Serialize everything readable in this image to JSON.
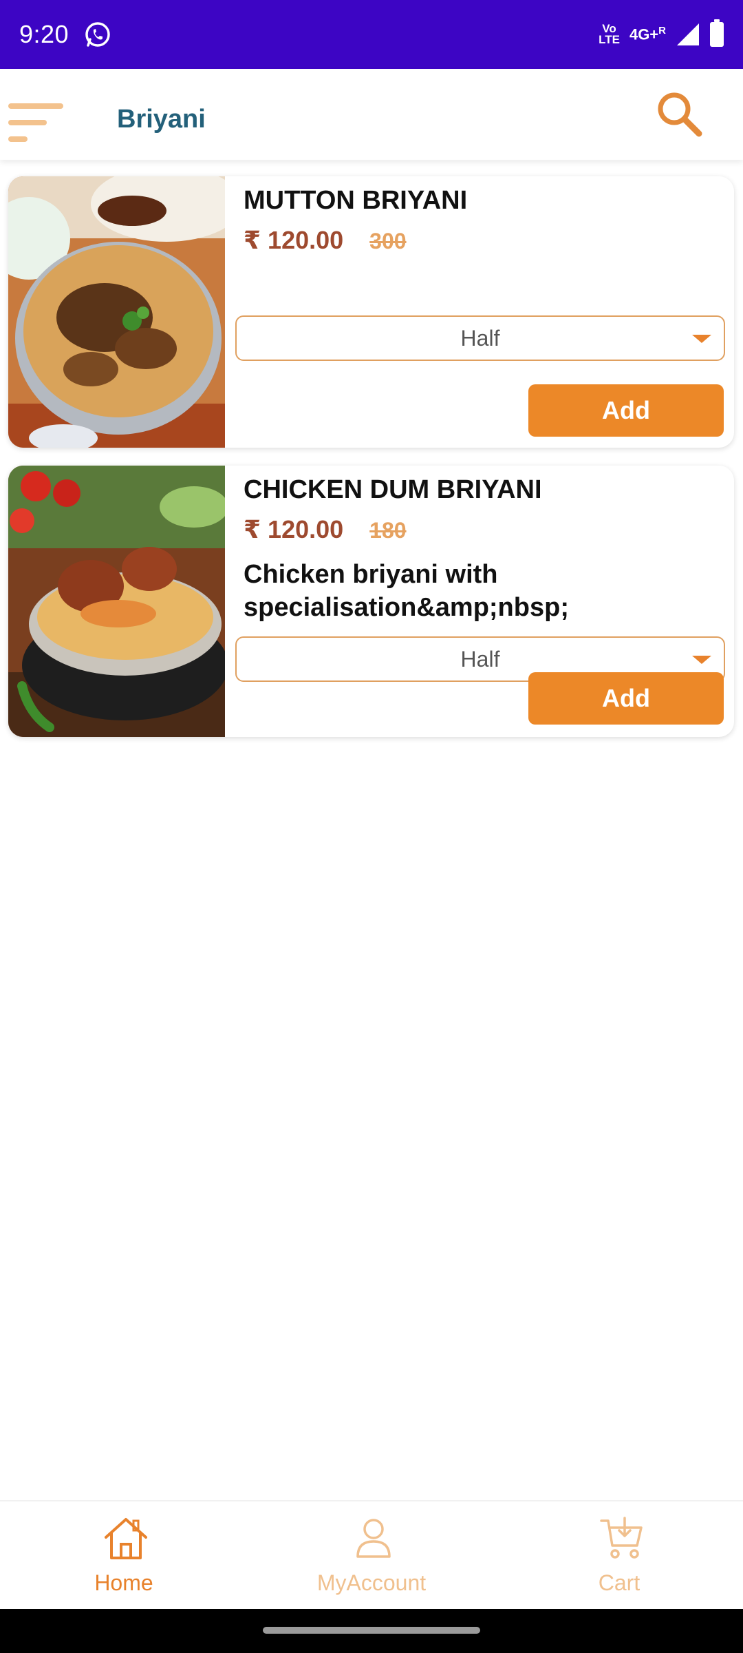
{
  "status_bar": {
    "time": "9:20",
    "volte_top": "Vo",
    "volte_bottom": "LTE",
    "network": "4G+",
    "roaming": "R"
  },
  "header": {
    "title": "Briyani",
    "menu_icon": "menu-icon",
    "search_icon": "search-icon"
  },
  "products": [
    {
      "name": "MUTTON BRIYANI",
      "price": "₹ 120.00",
      "mrp": "300",
      "description": "",
      "variant": "Half",
      "add_label": "Add"
    },
    {
      "name": "CHICKEN DUM BRIYANI",
      "price": "₹ 120.00",
      "mrp": "180",
      "description": "Chicken briyani with specialisation&amp;nbsp;",
      "variant": "Half",
      "add_label": "Add"
    }
  ],
  "bottom_nav": {
    "items": [
      {
        "label": "Home",
        "icon": "home-icon",
        "active": true
      },
      {
        "label": "MyAccount",
        "icon": "user-icon",
        "active": false
      },
      {
        "label": "Cart",
        "icon": "cart-icon",
        "active": false
      }
    ]
  },
  "colors": {
    "status_bar": "#3d05c4",
    "title": "#23607a",
    "accent": "#ec8828",
    "price": "#9e4a2f",
    "mrp": "#e6a260"
  }
}
